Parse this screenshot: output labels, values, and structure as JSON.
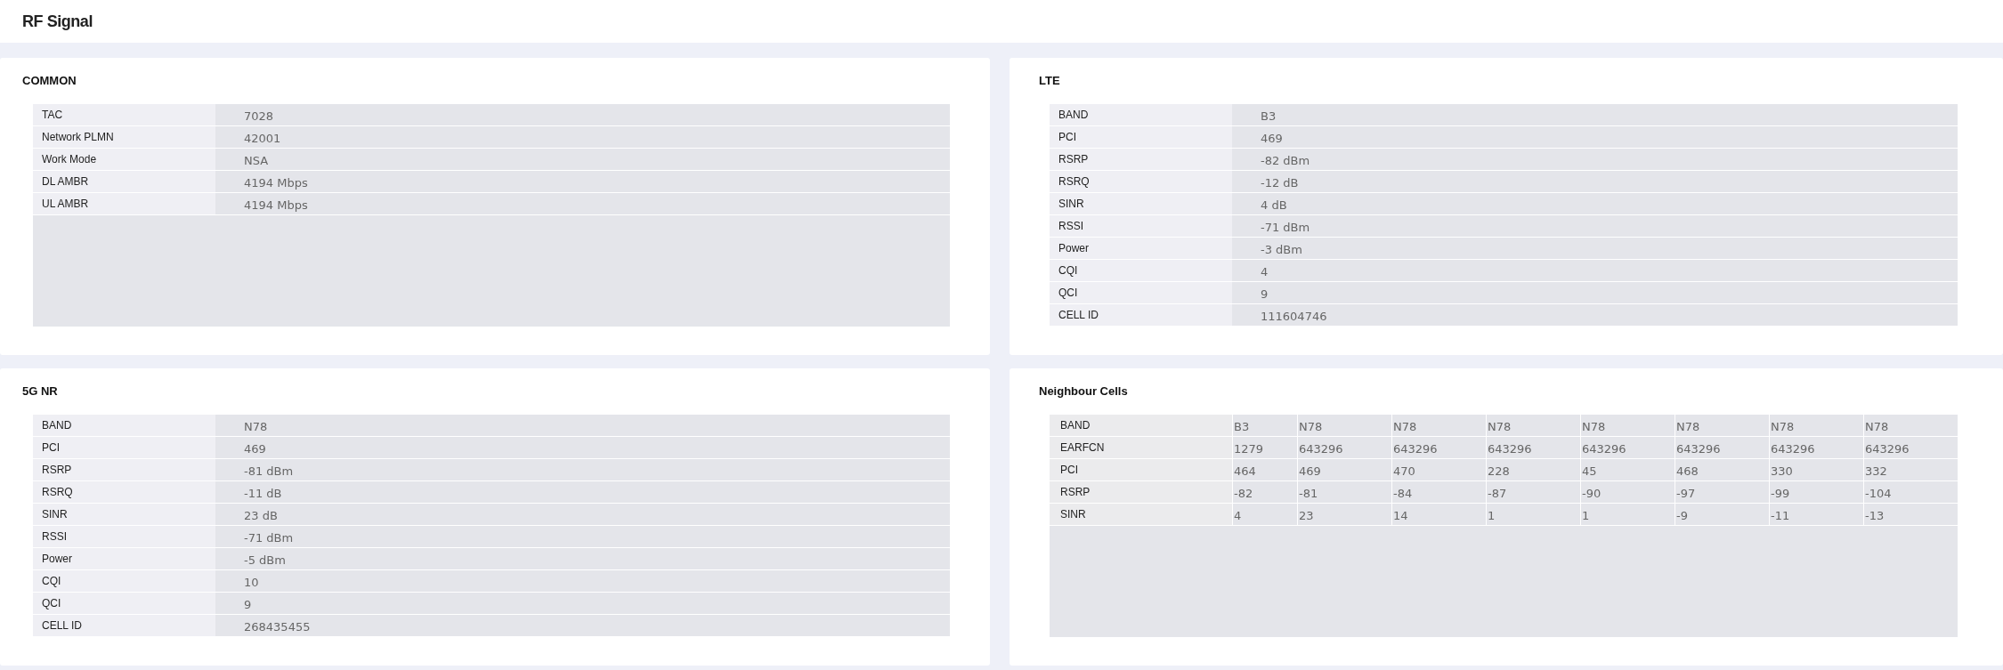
{
  "title": "RF Signal",
  "common": {
    "title": "COMMON",
    "rows": [
      {
        "label": "TAC",
        "value": "7028"
      },
      {
        "label": "Network PLMN",
        "value": "42001"
      },
      {
        "label": "Work Mode",
        "value": "NSA"
      },
      {
        "label": "DL AMBR",
        "value": "4194 Mbps"
      },
      {
        "label": "UL AMBR",
        "value": "4194 Mbps"
      }
    ]
  },
  "lte": {
    "title": "LTE",
    "rows": [
      {
        "label": "BAND",
        "value": "B3"
      },
      {
        "label": "PCI",
        "value": "469"
      },
      {
        "label": "RSRP",
        "value": "-82 dBm"
      },
      {
        "label": "RSRQ",
        "value": "-12 dB"
      },
      {
        "label": "SINR",
        "value": "4 dB"
      },
      {
        "label": "RSSI",
        "value": "-71 dBm"
      },
      {
        "label": "Power",
        "value": "-3 dBm"
      },
      {
        "label": "CQI",
        "value": "4"
      },
      {
        "label": "QCI",
        "value": "9"
      },
      {
        "label": "CELL ID",
        "value": "111604746"
      }
    ]
  },
  "nr": {
    "title": "5G NR",
    "rows": [
      {
        "label": "BAND",
        "value": "N78"
      },
      {
        "label": "PCI",
        "value": "469"
      },
      {
        "label": "RSRP",
        "value": "-81 dBm"
      },
      {
        "label": "RSRQ",
        "value": "-11 dB"
      },
      {
        "label": "SINR",
        "value": "23 dB"
      },
      {
        "label": "RSSI",
        "value": "-71 dBm"
      },
      {
        "label": "Power",
        "value": "-5 dBm"
      },
      {
        "label": "CQI",
        "value": "10"
      },
      {
        "label": "QCI",
        "value": "9"
      },
      {
        "label": "CELL ID",
        "value": "268435455"
      }
    ]
  },
  "neighbour_cells": {
    "title": "Neighbour Cells",
    "rows": [
      {
        "label": "BAND",
        "cells": [
          "B3",
          "N78",
          "N78",
          "N78",
          "N78",
          "N78",
          "N78",
          "N78"
        ]
      },
      {
        "label": "EARFCN",
        "cells": [
          "1279",
          "643296",
          "643296",
          "643296",
          "643296",
          "643296",
          "643296",
          "643296"
        ]
      },
      {
        "label": "PCI",
        "cells": [
          "464",
          "469",
          "470",
          "228",
          "45",
          "468",
          "330",
          "332"
        ]
      },
      {
        "label": "RSRP",
        "cells": [
          "-82",
          "-81",
          "-84",
          "-87",
          "-90",
          "-97",
          "-99",
          "-104"
        ]
      },
      {
        "label": "SINR",
        "cells": [
          "4",
          "23",
          "14",
          "1",
          "1",
          "-9",
          "-11",
          "-13"
        ]
      }
    ]
  }
}
